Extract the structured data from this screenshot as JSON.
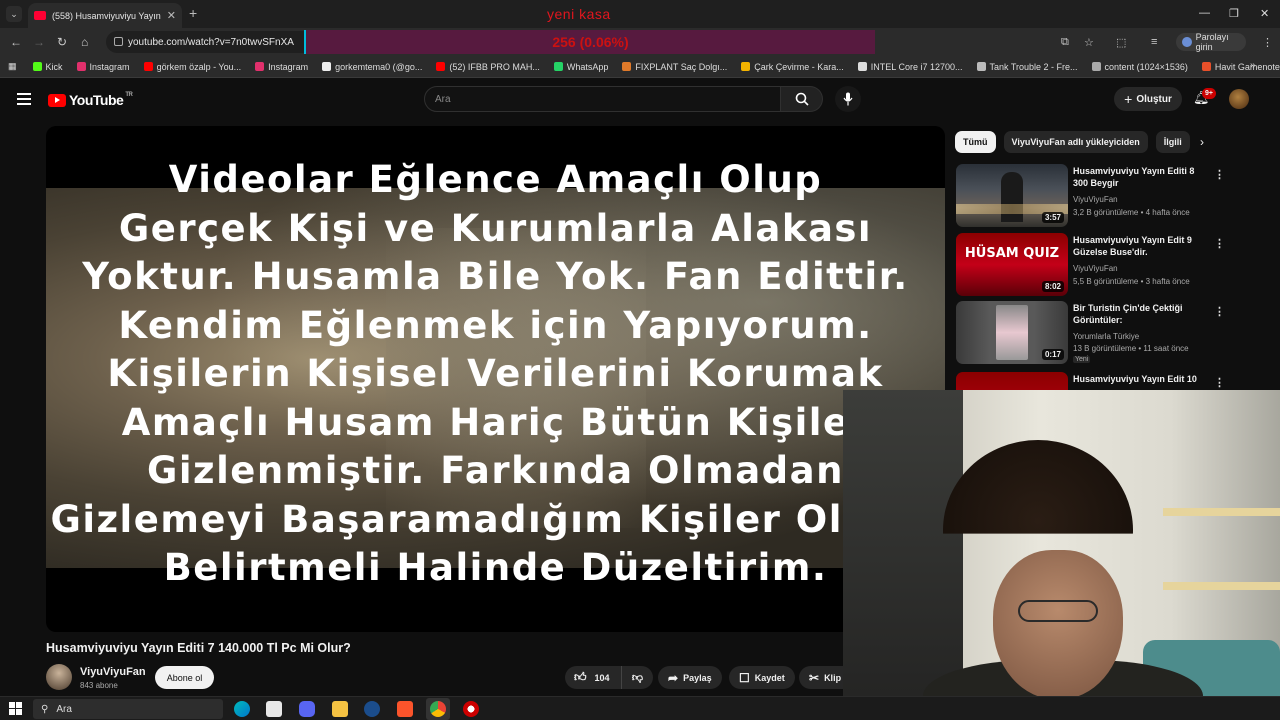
{
  "browser": {
    "tab_title": "(558) Husamviyuviyu Yayın Editi 7",
    "overlay_title": "yeni kasa",
    "url": "youtube.com/watch?v=7n0twvSFnXA",
    "counter_text": "256 (0.06%)",
    "password_label": "Parolayı girin",
    "bookmarks": [
      {
        "label": "Kick",
        "color": "#53fc18"
      },
      {
        "label": "Instagram",
        "color": "#e1306c"
      },
      {
        "label": "görkem özalp - You...",
        "color": "#ff0000"
      },
      {
        "label": "Instagram",
        "color": "#e1306c"
      },
      {
        "label": "gorkemtema0 (@go...",
        "color": "#eeeeee"
      },
      {
        "label": "(52) IFBB PRO MAH...",
        "color": "#ff0000"
      },
      {
        "label": "WhatsApp",
        "color": "#25d366"
      },
      {
        "label": "FIXPLANT Saç Dolgı...",
        "color": "#e07a2a"
      },
      {
        "label": "Çark Çevirme - Kara...",
        "color": "#f5b400"
      },
      {
        "label": "INTEL Core i7 12700...",
        "color": "#dddddd"
      },
      {
        "label": "Tank Trouble 2 - Fre...",
        "color": "#bbbbbb"
      },
      {
        "label": "content (1024×1536)",
        "color": "#aaaaaa"
      },
      {
        "label": "Havit Gamenote GK...",
        "color": "#e8502a"
      }
    ]
  },
  "youtube": {
    "logo_text": "YouTube",
    "country_code": "TR",
    "search_placeholder": "Ara",
    "create_label": "Oluştur",
    "notification_count": "9+"
  },
  "video": {
    "overlay_lines": [
      "Videolar Eğlence Amaçlı Olup",
      "Gerçek Kişi ve Kurumlarla Alakası",
      "Yoktur. Husamla Bile Yok. Fan Edittir.",
      "Kendim Eğlenmek için Yapıyorum.",
      "Kişilerin Kişisel Verilerini Korumak",
      "Amaçlı Husam Hariç Bütün Kişiler",
      "Gizlenmiştir. Farkında Olmadan",
      "Gizlemeyi Başaramadığım Kişiler Olursa",
      "Belirtmeli Halinde Düzeltirim."
    ],
    "title": "Husamviyuviyu Yayın Editi 7 140.000 Tl Pc Mi Olur?",
    "channel_name": "ViyuViyuFan",
    "channel_subs": "843 abone",
    "subscribe_label": "Abone ol",
    "like_count": "104",
    "share_label": "Paylaş",
    "save_label": "Kaydet",
    "clip_label": "Klip"
  },
  "sidebar": {
    "chips": [
      "Tümü",
      "ViyuViyuFan adlı yükleyiciden",
      "İlgili"
    ],
    "recommendations": [
      {
        "title": "Husamviyuviyu Yayın Editi 8 300 Beygir",
        "channel": "ViyuViyuFan",
        "meta": "3,2 B görüntüleme • 4 hafta önce",
        "duration": "3:57",
        "badge": ""
      },
      {
        "title": "Husamviyuviyu Yayın Edit 9 Güzelse Buse'dir.",
        "channel": "ViyuViyuFan",
        "meta": "5,5 B görüntüleme • 3 hafta önce",
        "duration": "8:02",
        "thumb_text": "HÜSAM QUIZ",
        "badge": ""
      },
      {
        "title": "Bir Turistin Çin'de Çektiği Görüntüler:",
        "channel": "Yorumlarla Türkiye",
        "meta": "13 B görüntüleme • 11 saat önce",
        "duration": "0:17",
        "badge": "Yeni"
      },
      {
        "title": "Husamviyuviyu Yayın Edit 10",
        "channel": "",
        "meta": "",
        "duration": "",
        "badge": ""
      }
    ]
  },
  "taskbar": {
    "search_label": "Ara"
  }
}
